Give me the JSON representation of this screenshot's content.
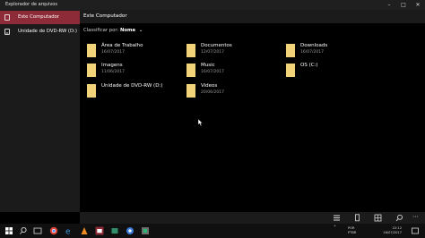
{
  "window": {
    "title": "Explorador de arquivos"
  },
  "sidebar": {
    "items": [
      {
        "label": "Este Computador",
        "icon": "computer-icon",
        "active": true
      },
      {
        "label": "Unidade de DVD-RW (D:)",
        "icon": "dvd-drive-icon",
        "active": false
      }
    ]
  },
  "main": {
    "header_title": "Este Computador",
    "sort_label": "Classificar por:",
    "sort_value": "Nome",
    "folders": [
      {
        "name": "Área de Trabalho",
        "date": "16/07/2017"
      },
      {
        "name": "Documentos",
        "date": "12/07/2017"
      },
      {
        "name": "Downloads",
        "date": "16/07/2017"
      },
      {
        "name": "Imagens",
        "date": "11/06/2017"
      },
      {
        "name": "Music",
        "date": "16/07/2017"
      },
      {
        "name": "OS (C:)",
        "date": ""
      },
      {
        "name": "Unidade de DVD-RW (D:)",
        "date": ""
      },
      {
        "name": "Videos",
        "date": "20/06/2017"
      }
    ]
  },
  "taskbar": {
    "lang": "POR",
    "lang2": "PTBR",
    "time": "22:12",
    "date": "16/07/2017"
  },
  "colors": {
    "accent": "#8e2b38",
    "folder": "#f2d37a",
    "sidebar": "#1b1b1b"
  }
}
